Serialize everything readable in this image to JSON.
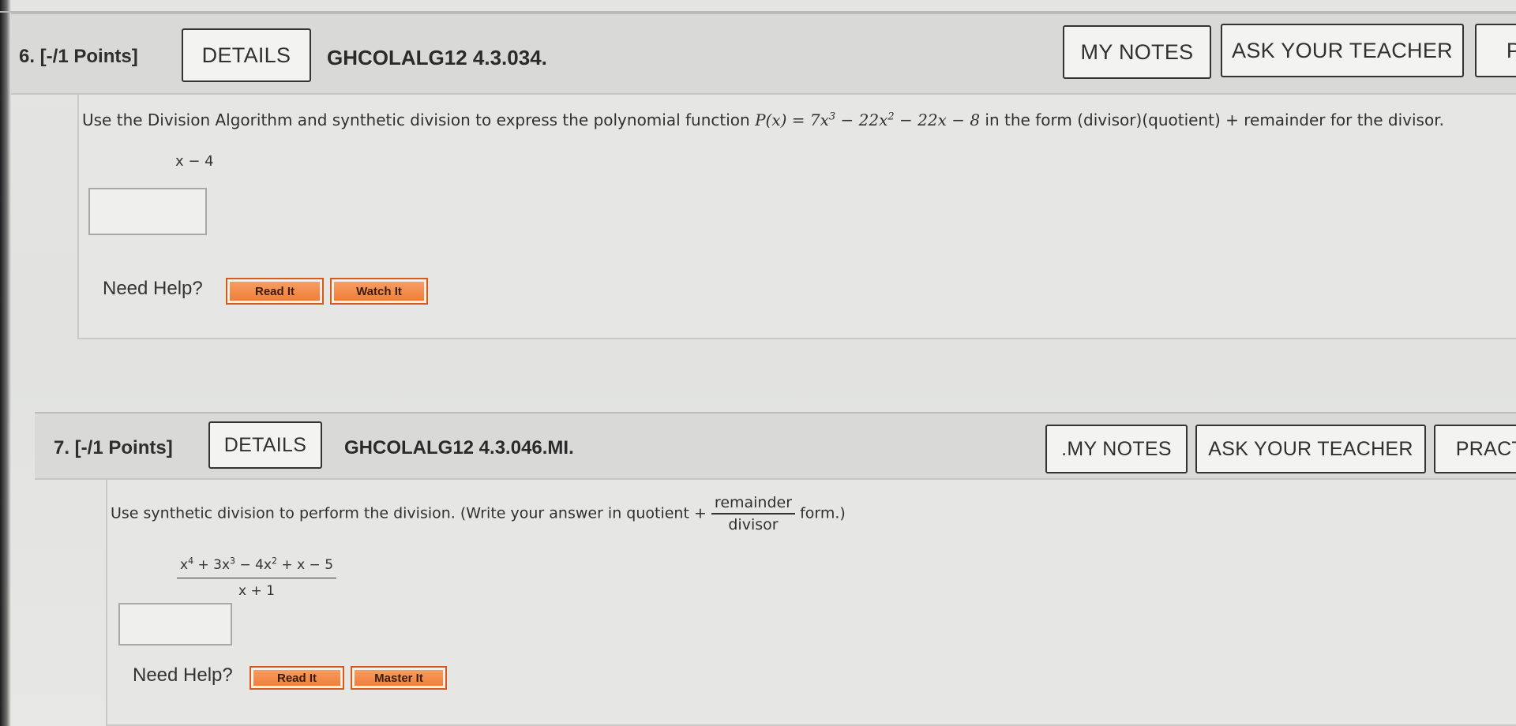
{
  "q6": {
    "number_label": "6. [-/1 Points]",
    "details_label": "DETAILS",
    "code": "GHCOLALG12 4.3.034.",
    "my_notes_label": "MY NOTES",
    "ask_teacher_label": "ASK YOUR TEACHER",
    "practice_label": "PI",
    "prompt_before": "Use the Division Algorithm and synthetic division to express the polynomial function ",
    "prompt_func": "P(x) = 7x",
    "prompt_exp1": "3",
    "prompt_mid1": " − 22x",
    "prompt_exp2": "2",
    "prompt_mid2": " − 22x − 8",
    "prompt_after": " in the form (divisor)(quotient) + remainder for the divisor.",
    "divisor": "x − 4",
    "answer_value": "",
    "need_help_label": "Need Help?",
    "read_it_label": "Read It",
    "watch_it_label": "Watch It"
  },
  "q7": {
    "number_label": "7. [-/1 Points]",
    "details_label": "DETAILS",
    "code": "GHCOLALG12 4.3.046.MI.",
    "my_notes_label": ".MY NOTES",
    "ask_teacher_label": "ASK YOUR TEACHER",
    "practice_label": "PRACT",
    "prompt_before": "Use synthetic division to perform the division. (Write your answer in quotient + ",
    "frac_num": "remainder",
    "frac_den": "divisor",
    "prompt_after": " form.)",
    "dividend_t1": "x",
    "dividend_e1": "4",
    "dividend_t2": " + 3x",
    "dividend_e2": "3",
    "dividend_t3": " − 4x",
    "dividend_e3": "2",
    "dividend_t4": " + x − 5",
    "divisor": "x + 1",
    "answer_value": "",
    "need_help_label": "Need Help?",
    "read_it_label": "Read It",
    "master_it_label": "Master It"
  },
  "colors": {
    "header_bg": "#d9dad8",
    "body_bg": "#e6e6e4",
    "help_button": "#f07a34",
    "button_border": "#333333"
  }
}
